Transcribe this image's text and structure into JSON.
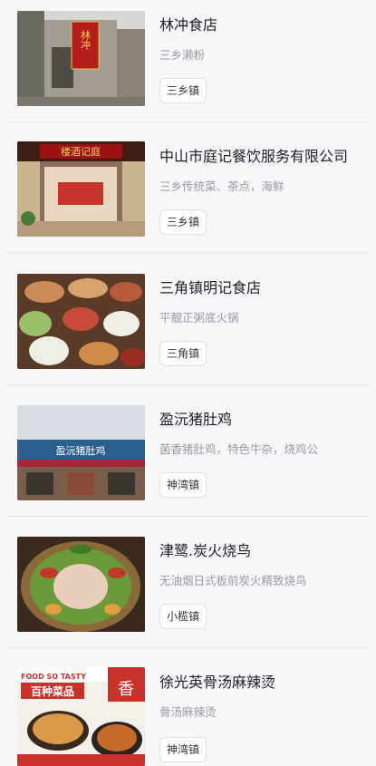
{
  "restaurants": [
    {
      "name": "林冲食店",
      "desc": "三乡濑粉",
      "town": "三乡镇",
      "image_icon": "restaurant-storefront-image",
      "sign_text": "林冲"
    },
    {
      "name": "中山市庭记餐饮服务有限公司",
      "desc": "三乡传统菜、茶点，海鲜",
      "town": "三乡镇",
      "image_icon": "restaurant-hall-image",
      "sign_text": "楼酒记庭"
    },
    {
      "name": "三角镇明记食店",
      "desc": "平靓正粥底火锅",
      "town": "三角镇",
      "image_icon": "hotpot-dishes-image"
    },
    {
      "name": "盈沅猪肚鸡",
      "desc": "菌香猪肚鸡，特色牛杂，烧鸡公",
      "town": "神湾镇",
      "image_icon": "storefront-sign-image",
      "sign_text": "盈沅猪肚鸡"
    },
    {
      "name": "津鹭.炭火烧鸟",
      "desc": "无油烟日式板前炭火精致烧鸟",
      "town": "小榄镇",
      "image_icon": "grilled-platter-image"
    },
    {
      "name": "徐光英骨汤麻辣烫",
      "desc": "骨汤麻辣烫",
      "town": "神湾镇",
      "image_icon": "food-poster-image",
      "poster": {
        "line1": "FOOD SO TASTY",
        "line2": "百种菜品",
        "badge": "香"
      }
    }
  ]
}
